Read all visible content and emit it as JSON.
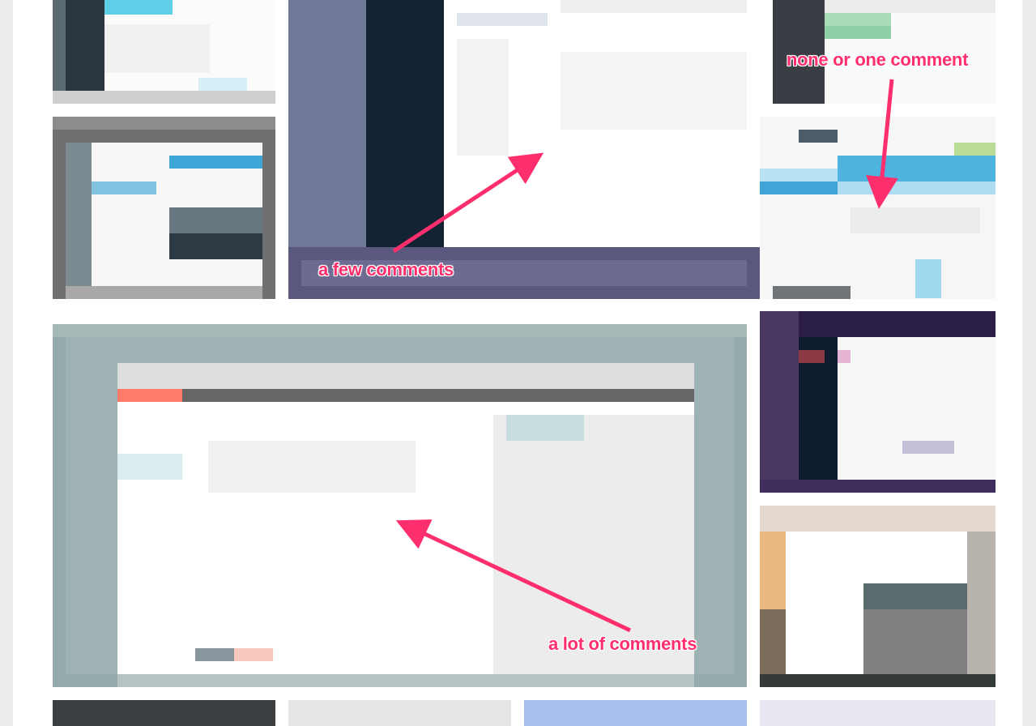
{
  "annotations": {
    "a_few_comments": "a few comments",
    "none_or_one_comment": "none or one comment",
    "a_lot_of_comments": "a lot of comments"
  },
  "colors": {
    "annotation": "#ff2f6e",
    "page_background": "#ececec"
  },
  "tiles": [
    {
      "name": "thumbnail-top-left-small",
      "dominant_color": "#2c3a44"
    },
    {
      "name": "thumbnail-left-middle",
      "dominant_color": "#6e6e6e"
    },
    {
      "name": "thumbnail-top-center-large",
      "dominant_color": "#6d6b91"
    },
    {
      "name": "thumbnail-top-right",
      "dominant_color": "#3a3d44"
    },
    {
      "name": "thumbnail-right-blue-rows",
      "dominant_color": "#4fb3e0"
    },
    {
      "name": "thumbnail-center-large-teal",
      "dominant_color": "#93aaab"
    },
    {
      "name": "thumbnail-right-purple",
      "dominant_color": "#3e2d5d"
    },
    {
      "name": "thumbnail-right-bottom-orange",
      "dominant_color": "#e9b77f"
    },
    {
      "name": "thumbnail-bottom-row",
      "dominant_color": "#a8c0ef"
    }
  ]
}
